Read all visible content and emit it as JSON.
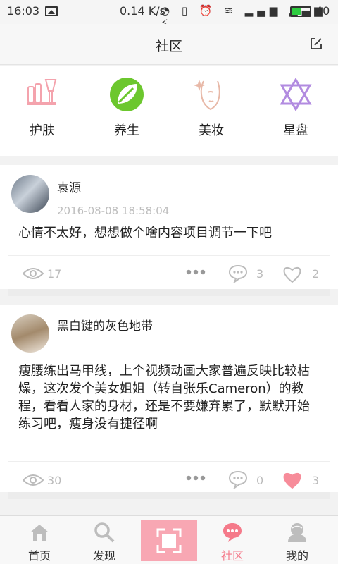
{
  "status_bar": {
    "time": "16:03",
    "speed": "0.14 K/s",
    "icons": "◔ ▯ ⏰ ≋ ▂▄▆ ▂▄▆ ⚡",
    "battery_percent": "40"
  },
  "header": {
    "title": "社区"
  },
  "categories": [
    {
      "label": "护肤",
      "icon": "makeup-brush-icon",
      "color": "#f4a3ad"
    },
    {
      "label": "养生",
      "icon": "leaf-icon",
      "color": "#6cc72e"
    },
    {
      "label": "美妆",
      "icon": "face-icon",
      "color": "#e8b9a8"
    },
    {
      "label": "星盘",
      "icon": "star-of-david-icon",
      "color": "#b28be0"
    }
  ],
  "posts": [
    {
      "author": "袁源",
      "date": "2016-08-08 18:58:04",
      "content": "心情不太好，想想做个啥内容项目调节一下吧",
      "views": "17",
      "comments": "3",
      "likes": "2",
      "liked": false
    },
    {
      "author": "黑白键的灰色地带",
      "content": "瘦腰练出马甲线，上个视频动画大家普遍反映比较枯燥，这次发个美女姐姐（转自张乐Cameron）的教程，看看人家的身材，还是不要嫌弃累了，默默开始练习吧，瘦身没有捷径啊",
      "views": "30",
      "comments": "0",
      "likes": "3",
      "liked": true
    }
  ],
  "bottom_nav": {
    "tabs": [
      {
        "label": "首页",
        "icon": "home-icon"
      },
      {
        "label": "发现",
        "icon": "search-icon"
      },
      {
        "label": "",
        "icon": "scan-icon"
      },
      {
        "label": "社区",
        "icon": "chat-icon",
        "active": true
      },
      {
        "label": "我的",
        "icon": "profile-icon"
      }
    ]
  },
  "colors": {
    "accent_pink": "#f57a8a",
    "scan_button": "#f8a7b3",
    "liked_heart": "#f78c9a"
  }
}
